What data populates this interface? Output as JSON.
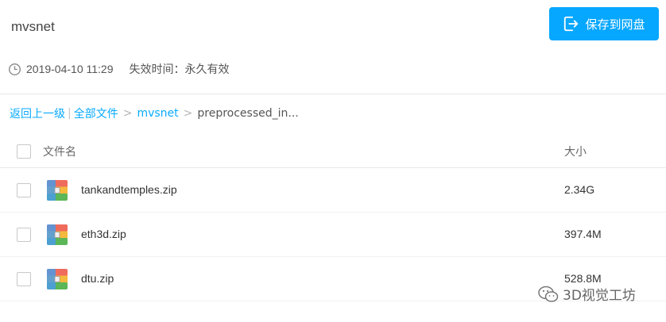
{
  "header": {
    "title": "mvsnet",
    "save_button_label": "保存到网盘"
  },
  "meta": {
    "timestamp": "2019-04-10 11:29",
    "expiry_label": "失效时间：永久有效"
  },
  "breadcrumb": {
    "back": "返回上一级",
    "all_files": "全部文件",
    "folder": "mvsnet",
    "current": "preprocessed_in..."
  },
  "table": {
    "col_name": "文件名",
    "col_size": "大小",
    "rows": [
      {
        "name": "tankandtemples.zip",
        "size": "2.34G",
        "icon": "archive-zip-icon"
      },
      {
        "name": "eth3d.zip",
        "size": "397.4M",
        "icon": "archive-zip-icon"
      },
      {
        "name": "dtu.zip",
        "size": "528.8M",
        "icon": "archive-zip-icon"
      }
    ]
  },
  "watermark": {
    "text": "3D视觉工坊",
    "icon": "wechat-icon"
  },
  "colors": {
    "accent": "#06a7ff",
    "link": "#09aaff"
  }
}
